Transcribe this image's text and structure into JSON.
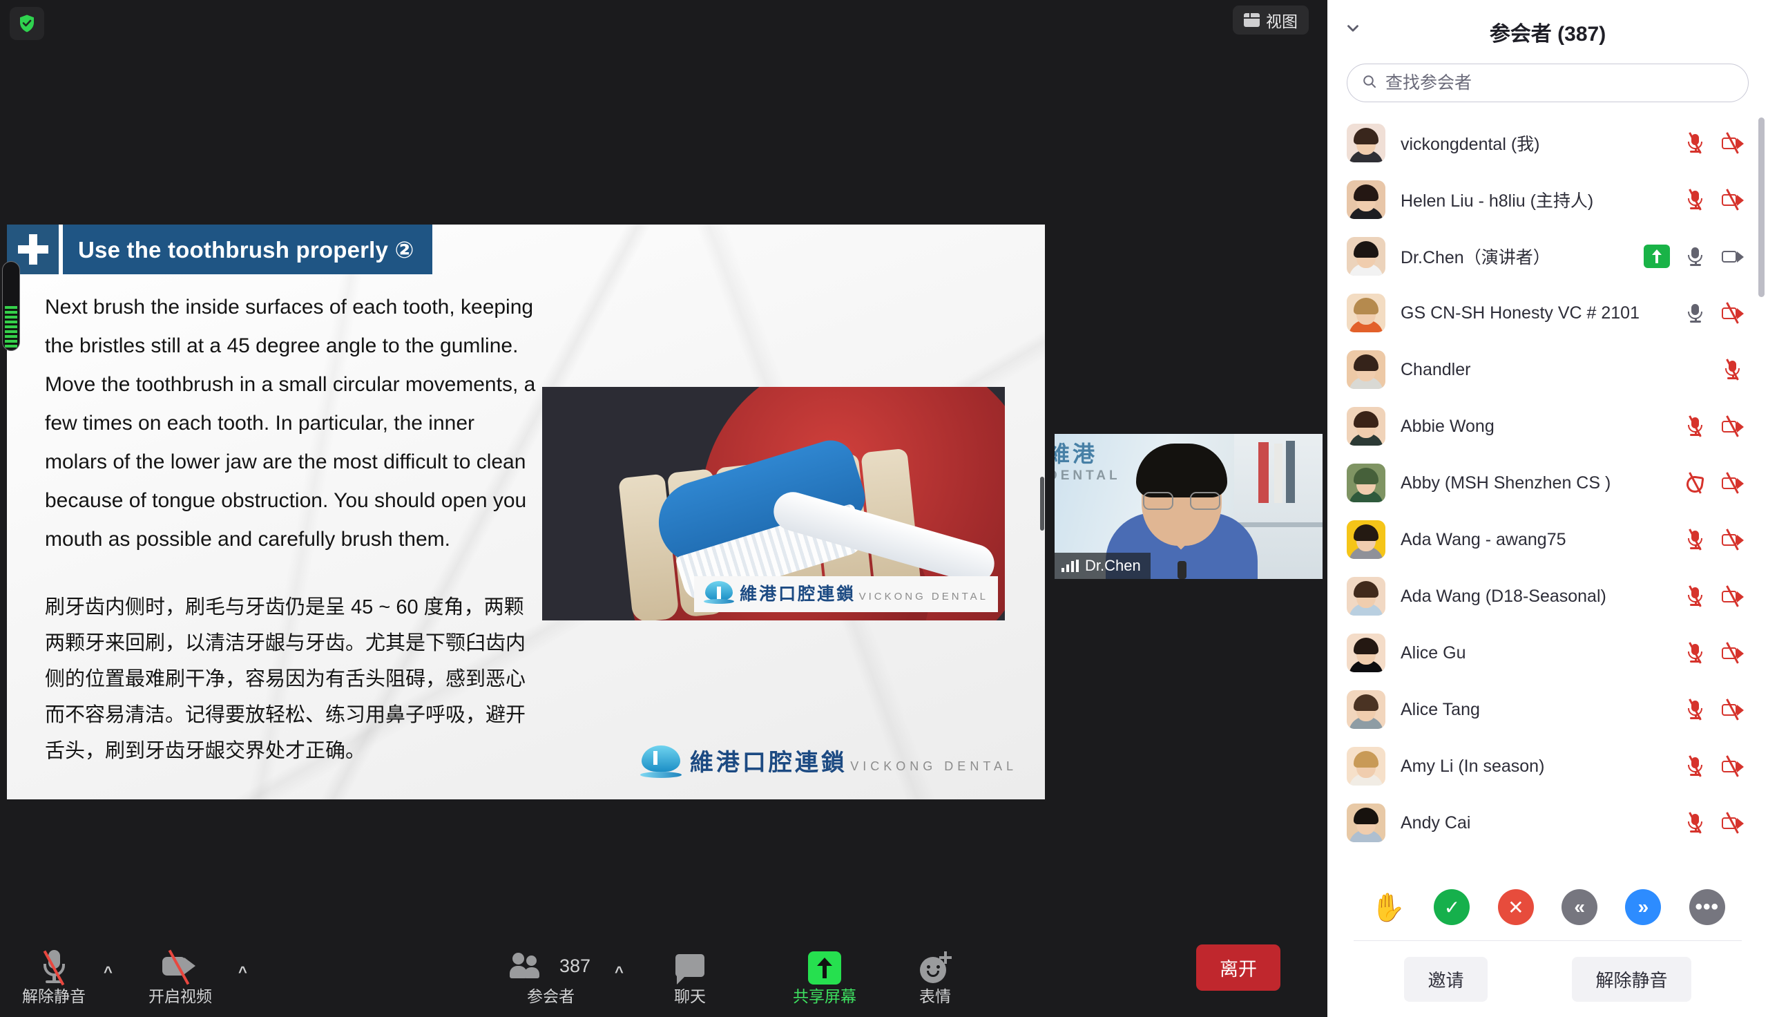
{
  "meeting": {
    "encryption_icon": "shield-check-icon",
    "view_button_label": "视图",
    "view_icon": "layout-grid-icon"
  },
  "shared_content": {
    "slide_title": "Use the toothbrush properly ②",
    "body_english": "Next brush the inside surfaces of each tooth, keeping the bristles still at a 45 degree angle to the gumline. Move the toothbrush in a small circular movements, a few times on each tooth. In particular, the inner molars of the lower jaw are the most difficult to clean because of tongue obstruction. You should open you mouth as possible and carefully brush them.",
    "body_chinese": "刷牙齿内侧时，刷毛与牙齿仍是呈 45 ~ 60 度角，两颗两颗牙来回刷，以清洁牙龈与牙齿。尤其是下颚臼齿内侧的位置最难刷干净，容易因为有舌头阻碍，感到恶心而不容易清洁。记得要放轻松、练习用鼻子呼吸，避开舌头，刷到牙齿牙龈交界处才正确。",
    "brand_cn": "維港口腔連鎖",
    "brand_en": "VICKONG DENTAL"
  },
  "speaker_thumbnail": {
    "name": "Dr.Chen",
    "audio_icon": "audio-level-bars-icon",
    "background_brand_cn": "維港",
    "background_brand_en": "DENTAL"
  },
  "toolbar": {
    "mute": {
      "label": "解除静音",
      "icon": "microphone-muted-icon",
      "caret": "^"
    },
    "video": {
      "label": "开启视频",
      "icon": "video-muted-icon",
      "caret": "^"
    },
    "participants": {
      "label": "参会者",
      "icon": "people-icon",
      "count": "387",
      "caret": "^"
    },
    "chat": {
      "label": "聊天",
      "icon": "chat-bubble-icon"
    },
    "share": {
      "label": "共享屏幕",
      "icon": "share-screen-icon"
    },
    "reactions": {
      "label": "表情",
      "icon": "reaction-smiley-icon"
    },
    "leave": {
      "label": "离开"
    }
  },
  "panel": {
    "title": "参会者 (387)",
    "collapse_icon": "chevron-down-icon",
    "search_placeholder": "查找参会者",
    "search_value": "",
    "search_icon": "search-icon",
    "participants": [
      {
        "name": "vickongdental (我)",
        "avatar": "#f0dfd6",
        "hair": "#39261c",
        "shirt": "#2f2f35",
        "icons": [
          "mic-off",
          "cam-off"
        ]
      },
      {
        "name": "Helen Liu - h8liu (主持人)",
        "avatar": "#e8c6a8",
        "hair": "#241713",
        "shirt": "#1d1d21",
        "icons": [
          "mic-off",
          "cam-off"
        ]
      },
      {
        "name": "Dr.Chen（演讲者）",
        "avatar": "#ecd3bb",
        "hair": "#1b1512",
        "shirt": "#f2f2f2",
        "icons": [
          "share-badge",
          "mic-on",
          "cam-on"
        ]
      },
      {
        "name": "GS CN-SH Honesty VC # 2101",
        "avatar": "#f3dcc2",
        "hair": "#b58a4e",
        "shirt": "#e2602a",
        "icons": [
          "mic-on",
          "cam-off"
        ]
      },
      {
        "name": "Chandler",
        "avatar": "#edc9a6",
        "hair": "#35231a",
        "shirt": "#d9d9d4",
        "icons": [
          "mic-off"
        ]
      },
      {
        "name": "Abbie Wong",
        "avatar": "#f0d3b9",
        "hair": "#3a2317",
        "shirt": "#2c3a35",
        "icons": [
          "mic-off",
          "cam-off"
        ]
      },
      {
        "name": "Abby (MSH Shenzhen CS )",
        "avatar": "#7f9463",
        "hair": "#46603a",
        "shirt": "#2f5a3c",
        "icons": [
          "phone-off",
          "cam-off"
        ]
      },
      {
        "name": "Ada Wang - awang75",
        "avatar": "#f5c518",
        "hair": "#241a12",
        "shirt": "#8f9199",
        "icons": [
          "mic-off",
          "cam-off"
        ]
      },
      {
        "name": "Ada Wang (D18-Seasonal)",
        "avatar": "#f1d8c3",
        "hair": "#412a1c",
        "shirt": "#b9cfe0",
        "icons": [
          "mic-off",
          "cam-off"
        ]
      },
      {
        "name": "Alice Gu",
        "avatar": "#f4dcc8",
        "hair": "#241812",
        "shirt": "#0d0d10",
        "icons": [
          "mic-off",
          "cam-off"
        ]
      },
      {
        "name": "Alice Tang",
        "avatar": "#f2d6bd",
        "hair": "#4a3323",
        "shirt": "#8e9ca4",
        "icons": [
          "mic-off",
          "cam-off"
        ]
      },
      {
        "name": "Amy Li (In season)",
        "avatar": "#f6e0c9",
        "hair": "#c89a57",
        "shirt": "#f1ece4",
        "icons": [
          "mic-off",
          "cam-off"
        ]
      },
      {
        "name": "Andy Cai",
        "avatar": "#e8c9a6",
        "hair": "#17120e",
        "shirt": "#aebfd0",
        "icons": [
          "mic-off",
          "cam-off"
        ]
      }
    ],
    "reactions": [
      {
        "name": "raise-hand",
        "glyph": "✋",
        "color": "#2d8cff"
      },
      {
        "name": "yes",
        "glyph": "✓",
        "color": "#16b04c"
      },
      {
        "name": "no",
        "glyph": "✕",
        "color": "#e74c3c"
      },
      {
        "name": "slower",
        "glyph": "«",
        "color": "#76767f"
      },
      {
        "name": "faster",
        "glyph": "»",
        "color": "#2d8cff"
      },
      {
        "name": "more",
        "glyph": "•••",
        "color": "#76767f"
      }
    ],
    "invite_label": "邀请",
    "unmute_label": "解除静音"
  },
  "colors": {
    "accent_green": "#26e04f",
    "leave_red": "#c0272d",
    "slide_blue": "#1f5584",
    "muted_red": "#d6332c"
  }
}
